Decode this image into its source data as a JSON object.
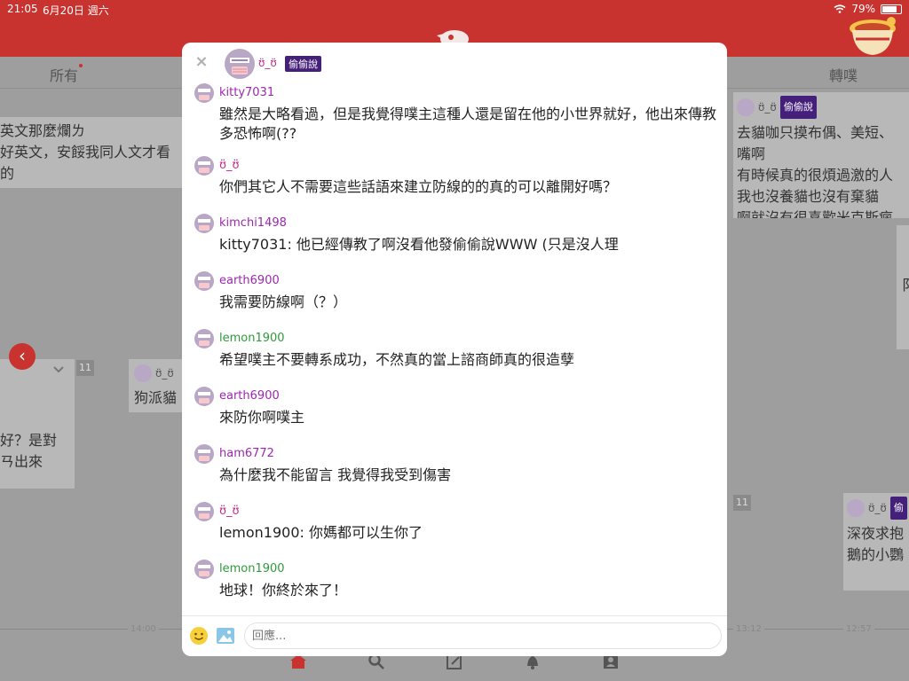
{
  "status_bar": {
    "time": "21:05",
    "date": "6月20日 週六",
    "battery": "79%",
    "battery_level": 0.79
  },
  "tabs": [
    {
      "label": "所有",
      "has_dot": true
    },
    {
      "label": "轉噗",
      "has_dot": false
    }
  ],
  "background": {
    "card_left_top": [
      "英文那麼爛ㄌ",
      "好英文，安餒我同人文才看的"
    ],
    "card_left_mid": [
      "好？是對",
      "ㄢ出來"
    ],
    "card_mid": {
      "user": "ʊ̈_ʊ̈",
      "text": "狗派貓"
    },
    "card_right_top": {
      "user": "ʊ̈_ʊ̈",
      "badge": "偷偷說",
      "lines": [
        "去貓咖只摸布偶、美短、",
        "嘴啊",
        "有時候真的很煩過激的人",
        "我也沒養貓也沒有棄貓",
        "啊就沒有很喜歡米克斯瘋"
      ]
    },
    "card_right_mid": {
      "text": "阝"
    },
    "card_right_bottom": {
      "user": "ʊ̈_ʊ̈",
      "badge": "偷",
      "lines": [
        "深夜求抱",
        "鵝的小鸚"
      ]
    },
    "num_tags": [
      "11",
      "11"
    ],
    "timeline_labels": [
      "14:00",
      "13:12",
      "12:57"
    ]
  },
  "modal": {
    "owner": {
      "name": "ʊ̈_ʊ̈",
      "badge": "偷偷說"
    },
    "responses": [
      {
        "user": "kitty7031",
        "color": "#9d27b0",
        "text": "雖然是大略看過，但是我覺得噗主這種人還是留在他的小世界就好，他出來傳教多恐怖啊(??"
      },
      {
        "user": "ʊ̈_ʊ̈",
        "color": "#c22f8a",
        "text": "你們其它人不需要這些話語來建立防線的的真的可以離開好嗎？"
      },
      {
        "user": "kimchi1498",
        "color": "#9d27b0",
        "text": "kitty7031: 他已經傳教了啊沒看他發偷偷說WWW (只是沒人理"
      },
      {
        "user": "earth6900",
        "color": "#9d27b0",
        "text": "我需要防線啊（？）"
      },
      {
        "user": "lemon1900",
        "color": "#2e9b3b",
        "text": "希望噗主不要轉系成功，不然真的當上諮商師真的很造孽"
      },
      {
        "user": "earth6900",
        "color": "#9d27b0",
        "text": "來防你啊噗主"
      },
      {
        "user": "ham6772",
        "color": "#9d27b0",
        "text": "為什麼我不能留言 我覺得我受到傷害"
      },
      {
        "user": "ʊ̈_ʊ̈",
        "color": "#c22f8a",
        "text": "lemon1900: 你媽都可以生你了"
      },
      {
        "user": "lemon1900",
        "color": "#2e9b3b",
        "text": "地球！你終於來了！"
      }
    ],
    "reply_placeholder": "回應..."
  }
}
